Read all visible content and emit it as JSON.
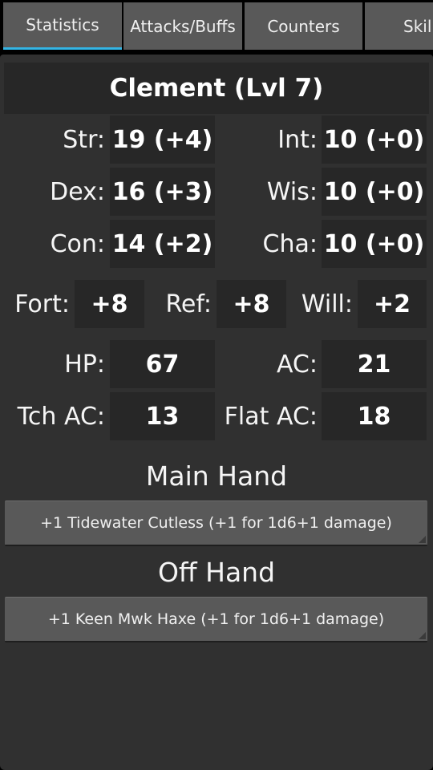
{
  "tabs": [
    {
      "label": "Statistics",
      "selected": true
    },
    {
      "label": "Attacks/Buffs",
      "selected": false
    },
    {
      "label": "Counters",
      "selected": false
    },
    {
      "label": "Skills",
      "selected": false
    }
  ],
  "accent_color": "#33b5e5",
  "character": {
    "title": "Clement (Lvl 7)"
  },
  "abilities": [
    {
      "left_label": "Str:",
      "left_value": "19 (+4)",
      "right_label": "Int:",
      "right_value": "10 (+0)"
    },
    {
      "left_label": "Dex:",
      "left_value": "16 (+3)",
      "right_label": "Wis:",
      "right_value": "10 (+0)"
    },
    {
      "left_label": "Con:",
      "left_value": "14 (+2)",
      "right_label": "Cha:",
      "right_value": "10 (+0)"
    }
  ],
  "saves": [
    {
      "label": "Fort:",
      "value": "+8"
    },
    {
      "label": "Ref:",
      "value": "+8"
    },
    {
      "label": "Will:",
      "value": "+2"
    }
  ],
  "defense": [
    {
      "left_label": "HP:",
      "left_value": "67",
      "right_label": "AC:",
      "right_value": "21"
    },
    {
      "left_label": "Tch AC:",
      "left_value": "13",
      "right_label": "Flat AC:",
      "right_value": "18"
    }
  ],
  "main_hand": {
    "heading": "Main Hand",
    "weapon": "+1 Tidewater Cutless (+1 for 1d6+1 damage)"
  },
  "off_hand": {
    "heading": "Off Hand",
    "weapon": "+1 Keen Mwk Haxe (+1 for 1d6+1 damage)"
  }
}
